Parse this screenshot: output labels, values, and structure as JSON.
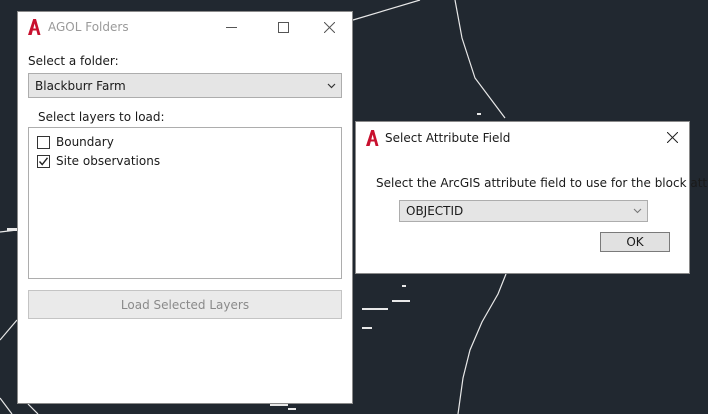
{
  "agol_window": {
    "title": "AGOL Folders",
    "folder_label": "Select a folder:",
    "folder_selected": "Blackburr Farm",
    "layers_label": "Select layers to load:",
    "layers": [
      {
        "label": "Boundary",
        "checked": false
      },
      {
        "label": "Site observations",
        "checked": true
      }
    ],
    "load_button": "Load Selected Layers"
  },
  "attribute_dialog": {
    "title": "Select Attribute Field",
    "prompt": "Select the ArcGIS attribute field to use for the block attr",
    "field_selected": "OBJECTID",
    "ok_button": "OK"
  },
  "colors": {
    "cad_background": "#212830",
    "brand_red": "#c8102e"
  }
}
